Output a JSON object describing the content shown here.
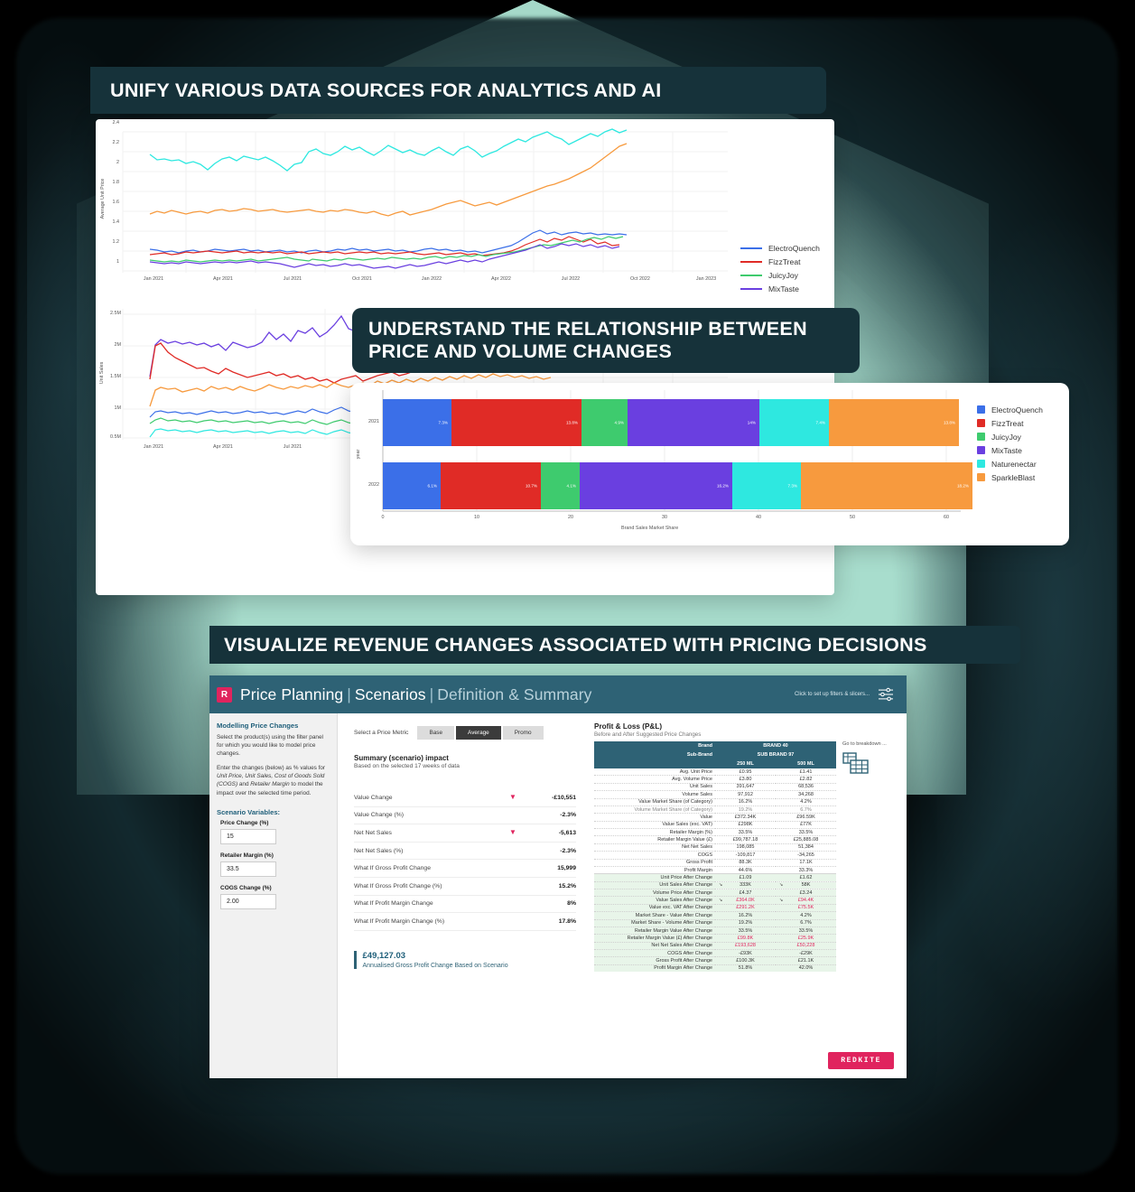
{
  "banners": {
    "b1": "UNIFY VARIOUS DATA SOURCES FOR ANALYTICS AND AI",
    "b2_line1": "UNDERSTAND THE RELATIONSHIP BETWEEN",
    "b2_line2": "PRICE AND VOLUME CHANGES",
    "b3": "VISUALIZE REVENUE CHANGES ASSOCIATED WITH PRICING DECISIONS"
  },
  "colors": {
    "banner_bg": "#16323A",
    "teal": "#A8DDCD",
    "accent_pink": "#E0245E",
    "dash_header": "#2E6275",
    "brand_blue": "#3B6FE8",
    "brand_red": "#E02B26",
    "brand_green": "#3ECB6E",
    "brand_purple": "#6A3FE0",
    "brand_cyan": "#2EE8E0",
    "brand_orange": "#F79A3E"
  },
  "chart_data": [
    {
      "type": "line",
      "title": "",
      "ylabel": "Average Unit Price",
      "xlabel": "",
      "ylim": [
        1,
        2.4
      ],
      "yticks": [
        "1",
        "1.2",
        "1.4",
        "1.6",
        "1.8",
        "2",
        "2.2",
        "2.4"
      ],
      "xticks": [
        "Jan 2021",
        "Apr 2021",
        "Jul 2021",
        "Oct 2021",
        "Jan 2022",
        "Apr 2022",
        "Jul 2022",
        "Oct 2022",
        "Jan 2023"
      ],
      "grid": true,
      "legend_position": "right",
      "series": [
        {
          "name": "ElectroQuench",
          "color": "#3B6FE8",
          "approx_range": [
            1.15,
            1.55
          ]
        },
        {
          "name": "FizzTreat",
          "color": "#E02B26",
          "approx_range": [
            1.15,
            1.55
          ]
        },
        {
          "name": "JuicyJoy",
          "color": "#3ECB6E",
          "approx_range": [
            1.08,
            1.3
          ]
        },
        {
          "name": "MixTaste",
          "color": "#6A3FE0",
          "approx_range": [
            1.05,
            1.25
          ]
        },
        {
          "name": "Naturenectar",
          "color": "#2EE8E0",
          "approx_range": [
            1.95,
            2.35
          ]
        },
        {
          "name": "SparkleBlast",
          "color": "#F79A3E",
          "approx_range": [
            1.5,
            2.1
          ]
        }
      ]
    },
    {
      "type": "line",
      "title": "",
      "ylabel": "Unit Sales",
      "xlabel": "",
      "yticks": [
        "0.5M",
        "1M",
        "1.5M",
        "2M",
        "2.5M"
      ],
      "xticks": [
        "Jan 2021",
        "Apr 2021",
        "Jul 2021"
      ],
      "grid": true,
      "series": [
        {
          "name": "MixTaste",
          "color": "#6A3FE0",
          "approx_range": [
            1.9,
            2.6
          ]
        },
        {
          "name": "FizzTreat",
          "color": "#E02B26",
          "approx_range": [
            1.55,
            2.15
          ]
        },
        {
          "name": "SparkleBlast",
          "color": "#F79A3E",
          "approx_range": [
            1.1,
            1.55
          ]
        },
        {
          "name": "ElectroQuench",
          "color": "#3B6FE8",
          "approx_range": [
            0.85,
            1.05
          ]
        },
        {
          "name": "JuicyJoy",
          "color": "#3ECB6E",
          "approx_range": [
            0.68,
            0.85
          ]
        },
        {
          "name": "Naturenectar",
          "color": "#2EE8E0",
          "approx_range": [
            0.5,
            0.68
          ]
        }
      ]
    },
    {
      "type": "bar",
      "orientation": "horizontal",
      "stacked": true,
      "xlabel": "Brand Sales Market Share",
      "ylabel": "year",
      "xticks": [
        "0",
        "10",
        "20",
        "30",
        "40",
        "50",
        "60"
      ],
      "xlim": [
        0,
        62
      ],
      "categories": [
        "2021",
        "2022"
      ],
      "legend_position": "right",
      "series": [
        {
          "name": "ElectroQuench",
          "color": "#3B6FE8",
          "values": [
            7.3,
            6.1
          ],
          "labels": [
            "7.3%",
            "6.1%"
          ]
        },
        {
          "name": "FizzTreat",
          "color": "#E02B26",
          "values": [
            13.8,
            10.7
          ],
          "labels": [
            "13.8%",
            "10.7%"
          ]
        },
        {
          "name": "JuicyJoy",
          "color": "#3ECB6E",
          "values": [
            4.9,
            4.1
          ],
          "labels": [
            "4.9%",
            "4.1%"
          ]
        },
        {
          "name": "MixTaste",
          "color": "#6A3FE0",
          "values": [
            14.0,
            16.2
          ],
          "labels": [
            "14%",
            "16.2%"
          ]
        },
        {
          "name": "Naturenectar",
          "color": "#2EE8E0",
          "values": [
            7.4,
            7.3
          ],
          "labels": [
            "7.4%",
            "7.3%"
          ]
        },
        {
          "name": "SparkleBlast",
          "color": "#F79A3E",
          "values": [
            13.8,
            18.2
          ],
          "labels": [
            "13.8%",
            "18.2%"
          ]
        }
      ]
    }
  ],
  "dashboard": {
    "logo": "R",
    "title_a": "Price Planning",
    "title_b": "Scenarios",
    "title_c": "Definition & Summary",
    "filters_hint": "Click to set up filters & slicers...",
    "left": {
      "heading": "Modelling Price Changes",
      "para1": "Select the product(s) using the filter panel for which you would like to model price changes.",
      "para2_pre": "Enter the changes (below) as % values for ",
      "para2_em1": "Unit Price, Unit Sales, Cost of Goods Sold (COGS)",
      "para2_mid": " and ",
      "para2_em2": "Retailer Margin",
      "para2_post": " to model the impact over the selected time period.",
      "vars_heading": "Scenario Variables:",
      "fields": [
        {
          "label": "Price Change (%)",
          "value": "15"
        },
        {
          "label": "Retailer Margin (%)",
          "value": "33.5"
        },
        {
          "label": "COGS Change (%)",
          "value": "2.00"
        }
      ]
    },
    "mid": {
      "metric_label": "Select a Price Metric",
      "metric_options": [
        "Base",
        "Average",
        "Promo"
      ],
      "metric_selected": "Average",
      "summary_title": "Summary (scenario) impact",
      "summary_sub": "Based on the selected 17 weeks of data",
      "rows": [
        {
          "label": "Value Change",
          "value": "-£10,551",
          "arrow": true
        },
        {
          "label": "Value Change (%)",
          "value": "-2.3%",
          "arrow": false
        },
        {
          "label": "Net Net Sales",
          "value": "-5,613",
          "arrow": true
        },
        {
          "label": "Net Net Sales (%)",
          "value": "-2.3%",
          "arrow": false
        },
        {
          "label": "What If Gross Profit Change",
          "value": "15,999",
          "arrow": false
        },
        {
          "label": "What If Gross Profit Change (%)",
          "value": "15.2%",
          "arrow": false
        },
        {
          "label": "What If Profit Margin Change",
          "value": "8%",
          "arrow": false
        },
        {
          "label": "What If Profit Margin Change (%)",
          "value": "17.8%",
          "arrow": false
        }
      ],
      "annual_value": "£49,127.03",
      "annual_label": "Annualised Gross Profit Change Based on Scenario"
    },
    "pl": {
      "title": "Profit & Loss (P&L)",
      "subtitle": "Before and After Suggested Price Changes",
      "brand_label": "Brand",
      "brand_value": "BRAND 40",
      "subbrand_label": "Sub-Brand",
      "subbrand_value": "SUB BRAND 97",
      "col1": "250 ML",
      "col2": "500 ML",
      "breakdown_link": "Go to breakdown ...",
      "rows_before": [
        {
          "label": "Avg. Unit Price",
          "c1": "£0.95",
          "c2": "£1.41"
        },
        {
          "label": "Avg. Volume Price",
          "c1": "£3.80",
          "c2": "£2.82"
        },
        {
          "label": "Unit Sales",
          "c1": "391,647",
          "c2": "68,536"
        },
        {
          "label": "Volume Sales",
          "c1": "97,912",
          "c2": "34,268"
        },
        {
          "label": "Value Market Share (of Category)",
          "c1": "16.2%",
          "c2": "4.2%"
        },
        {
          "label": "Volume Market Share (of Category)",
          "c1": "19.2%",
          "c2": "6.7%",
          "gray": true
        },
        {
          "label": "Value",
          "c1": "£372.34K",
          "c2": "£96.59K"
        },
        {
          "label": "Value Sales (exc. VAT)",
          "c1": "£298K",
          "c2": "£77K"
        },
        {
          "label": "Retailer Margin (%)",
          "c1": "33.5%",
          "c2": "33.5%"
        },
        {
          "label": "Retailer Margin Value (£)",
          "c1": "£99,787.18",
          "c2": "£25,885.08"
        },
        {
          "label": "Net Net Sales",
          "c1": "198,085",
          "c2": "51,384"
        },
        {
          "label": "COGS",
          "c1": "-109,817",
          "c2": "-34,265"
        },
        {
          "label": "Gross Profit",
          "c1": "88.3K",
          "c2": "17.1K"
        },
        {
          "label": "Profit Margin",
          "c1": "44.6%",
          "c2": "33.3%"
        }
      ],
      "rows_after": [
        {
          "label": "Unit Price After Change",
          "c1": "£1.09",
          "c2": "£1.62"
        },
        {
          "label": "Unit Sales After Change",
          "c1": "333K",
          "c2": "58K",
          "arrow": true
        },
        {
          "label": "Volume Price After Change",
          "c1": "£4.37",
          "c2": "£3.24"
        },
        {
          "label": "Value Sales After Change",
          "c1": "£364.0K",
          "c2": "£94.4K",
          "arrow": true,
          "red": true
        },
        {
          "label": "Value exc. VAT After Change",
          "c1": "£291.2K",
          "c2": "£75.5K",
          "red": true
        },
        {
          "label": "Market Share - Value After Change",
          "c1": "16.2%",
          "c2": "4.2%"
        },
        {
          "label": "Market Share - Volume After Change",
          "c1": "19.2%",
          "c2": "6.7%"
        },
        {
          "label": "Retailer Margin Value After Change",
          "c1": "33.5%",
          "c2": "33.5%"
        },
        {
          "label": "Retailer Margin Value (£) After Change",
          "c1": "£99.8K",
          "c2": "£25.9K",
          "red": true
        },
        {
          "label": "Net Net Sales After Change",
          "c1": "£193,628",
          "c2": "£50,228",
          "red": true
        },
        {
          "label": "COGS After Change",
          "c1": "-£93K",
          "c2": "-£29K"
        },
        {
          "label": "Gross Profit After Change",
          "c1": "£100.3K",
          "c2": "£21.1K"
        },
        {
          "label": "Profit Margin After Change",
          "c1": "51.8%",
          "c2": "42.0%"
        }
      ]
    },
    "footer_logo": "REDKITE"
  }
}
